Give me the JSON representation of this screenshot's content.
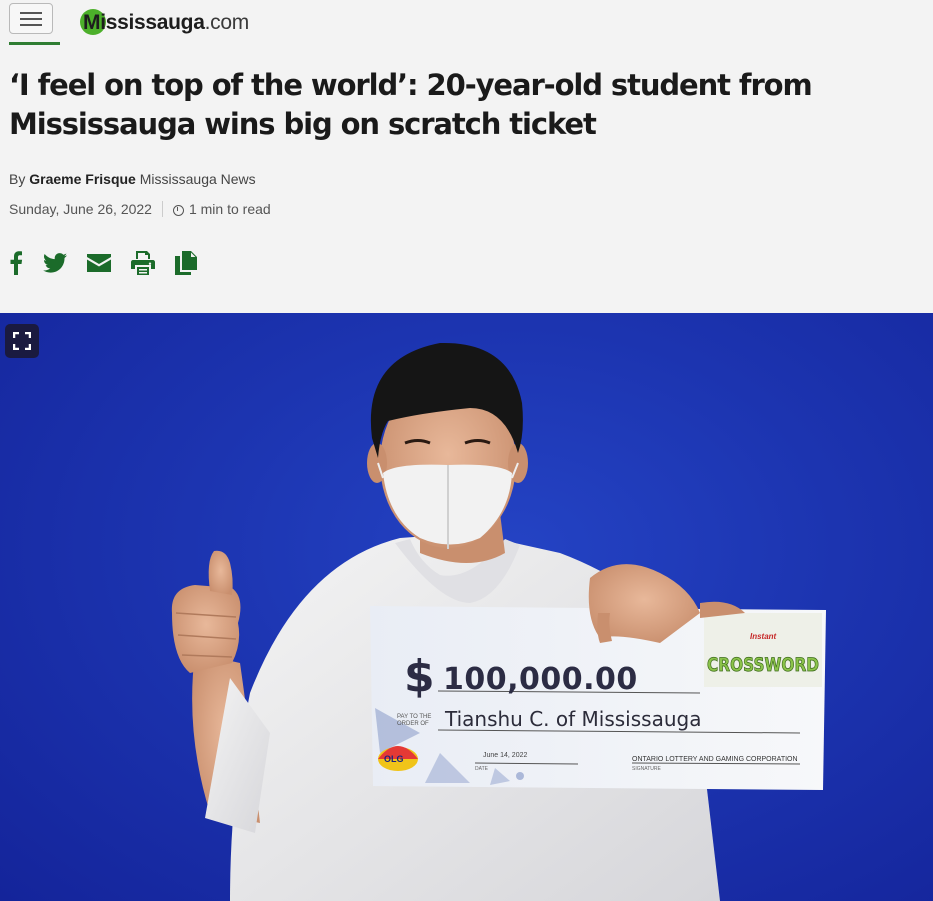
{
  "header": {
    "logo_brand": "Mississauga",
    "logo_suffix": ".com"
  },
  "article": {
    "headline": "‘I feel on top of the world’: 20-year-old student from Mississauga wins big on scratch ticket",
    "byline_prefix": "By",
    "author": "Graeme Frisque",
    "publication": "Mississauga News",
    "date": "Sunday, June 26, 2022",
    "read_time": "1 min to read"
  },
  "share": [
    "facebook-icon",
    "twitter-icon",
    "email-icon",
    "print-icon",
    "copy-icon"
  ],
  "photo": {
    "cheque_amount": "100,000.00",
    "cheque_currency": "$",
    "pay_to_label_1": "PAY TO THE",
    "pay_to_label_2": "ORDER OF",
    "payee": "Tianshu C. of Mississauga",
    "cheque_date": "June 14, 2022",
    "date_label": "DATE",
    "corporation": "ONTARIO LOTTERY AND GAMING CORPORATION",
    "signature_label": "SIGNATURE",
    "game_tag": "Instant",
    "game_name": "CROSSWORD",
    "olg_logo": "OLG"
  },
  "colors": {
    "accent_green": "#1b6b2a",
    "backdrop_blue": "#1c34b0"
  }
}
